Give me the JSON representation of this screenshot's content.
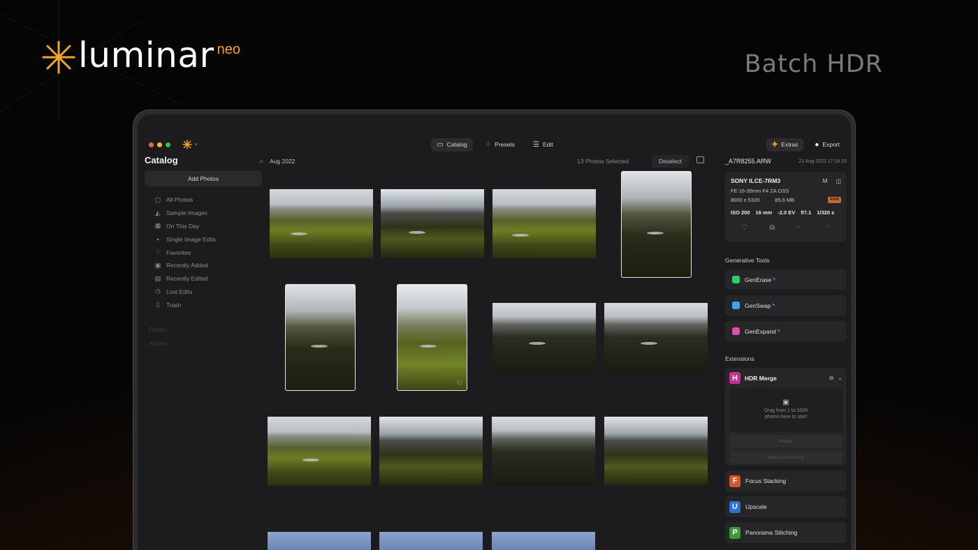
{
  "brand": {
    "name": "luminar",
    "suffix": "neo"
  },
  "hero_title": "Batch HDR",
  "toolbar": {
    "catalog_label": "Catalog",
    "presets_label": "Presets",
    "edit_label": "Edit",
    "extras_label": "Extras",
    "export_label": "Export"
  },
  "sidebar": {
    "title": "Catalog",
    "add_photos_label": "Add Photos",
    "items": [
      {
        "label": "All Photos",
        "icon": "photo-stack-icon"
      },
      {
        "label": "Sample Images",
        "icon": "graduation-cap-icon"
      },
      {
        "label": "On This Day",
        "icon": "calendar-icon"
      },
      {
        "label": "Single Image Edits",
        "icon": "grid-icon"
      },
      {
        "label": "Favorites",
        "icon": "heart-icon"
      },
      {
        "label": "Recently Added",
        "icon": "image-plus-icon"
      },
      {
        "label": "Recently Edited",
        "icon": "image-edit-icon"
      },
      {
        "label": "Lost Edits",
        "icon": "clock-icon"
      },
      {
        "label": "Trash",
        "icon": "trash-icon"
      }
    ],
    "faint_items": [
      "Folders",
      "Albums"
    ]
  },
  "grid": {
    "date_label": "Aug 2022",
    "selection_text": "13 Photos Selected",
    "deselect_label": "Deselect"
  },
  "info": {
    "file_name": "_A7R8255.ARW",
    "file_date": "21 Aug 2022 17:18:19",
    "camera": "SONY ILCE-7RM3",
    "mode": "M",
    "lens": "FE 16-35mm F4 ZA OSS",
    "resolution": "8000 x 5320",
    "file_size": "85,6 MB",
    "raw_badge": "RAW",
    "iso": "ISO 200",
    "focal": "16 mm",
    "ev": "-2.0 EV",
    "aperture": "f/7.1",
    "shutter": "1/320 s"
  },
  "generative_tools": {
    "title": "Generative Tools",
    "items": [
      {
        "label": "GenErase",
        "color": "#2ecc71"
      },
      {
        "label": "GenSwap",
        "color": "#3fa0ff"
      },
      {
        "label": "GenExpand",
        "color": "#e04fa8"
      }
    ]
  },
  "extensions": {
    "title": "Extensions",
    "hdr": {
      "letter": "H",
      "label": "HDR Merge",
      "drop_text_1": "Drag from 1 to 1000",
      "drop_text_2": "photos here to start",
      "merge_label": "Merge",
      "batch_label": "Batch Processing",
      "color": "#c2338f"
    },
    "items": [
      {
        "letter": "F",
        "label": "Focus Stacking",
        "color": "#d9532b"
      },
      {
        "letter": "U",
        "label": "Upscale",
        "color": "#2d6fd6"
      },
      {
        "letter": "P",
        "label": "Panorama Stitching",
        "color": "#3a9a3a"
      }
    ]
  },
  "colors": {
    "accent": "#f5a623",
    "window_red": "#ff5f57",
    "window_yellow": "#febc2e",
    "window_green": "#28c840"
  }
}
